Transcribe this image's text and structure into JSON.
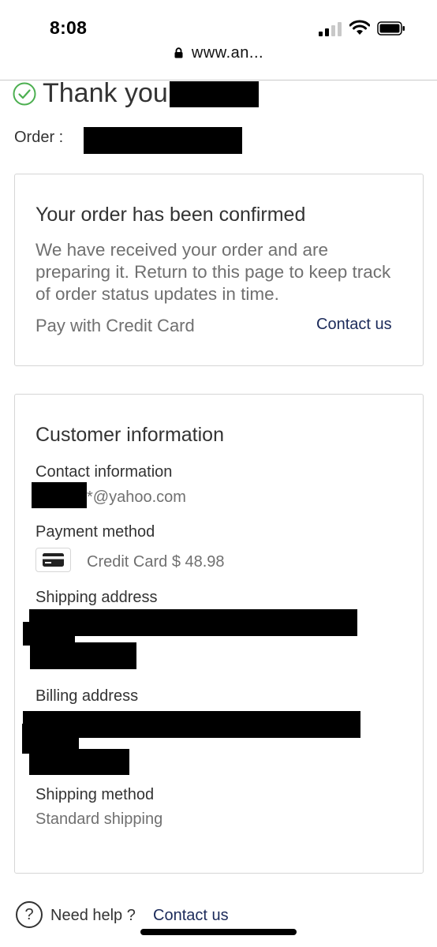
{
  "status_bar": {
    "time": "8:08",
    "url": "www.an..."
  },
  "header": {
    "thank_you": "Thank you",
    "order_label": "Order :"
  },
  "confirmation": {
    "title": "Your order has been confirmed",
    "body": "We have received your order and are preparing it. Return to this page to keep track of order status updates in time.",
    "payment_note": "Pay with Credit Card",
    "contact_label": "Contact us"
  },
  "customer_info": {
    "title": "Customer information",
    "contact_label": "Contact information",
    "email_suffix": "*@yahoo.com",
    "payment_label": "Payment method",
    "payment_value": "Credit Card $ 48.98",
    "shipping_address_label": "Shipping address",
    "billing_address_label": "Billing address",
    "shipping_method_label": "Shipping method",
    "shipping_method_value": "Standard shipping"
  },
  "footer": {
    "help_icon_glyph": "?",
    "need_help": "Need help ?",
    "contact_label": "Contact us"
  },
  "colors": {
    "accent_link": "#1b2a5a",
    "check_green": "#4caf50",
    "muted_text": "#707070"
  }
}
